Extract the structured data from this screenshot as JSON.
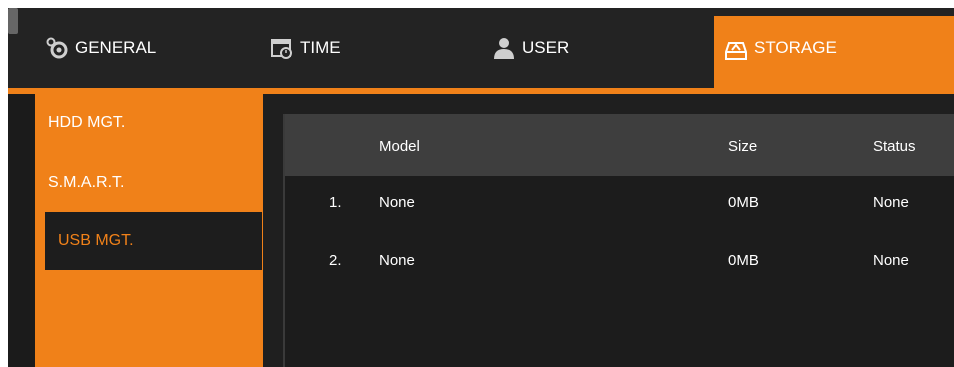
{
  "tabs": {
    "general": "GENERAL",
    "time": "TIME",
    "user": "USER",
    "storage": "STORAGE"
  },
  "sidebar": {
    "items": [
      {
        "label": "HDD MGT."
      },
      {
        "label": "S.M.A.R.T."
      },
      {
        "label": "USB MGT."
      }
    ]
  },
  "table": {
    "headers": {
      "model": "Model",
      "size": "Size",
      "status": "Status"
    },
    "rows": [
      {
        "num": "1.",
        "model": "None",
        "size": "0MB",
        "status": "None"
      },
      {
        "num": "2.",
        "model": "None",
        "size": "0MB",
        "status": "None"
      }
    ]
  },
  "colors": {
    "accent": "#f08119",
    "background": "#1b1b1b",
    "header": "#3e3e3e"
  },
  "icons": [
    "gear-icon",
    "calendar-icon",
    "user-icon",
    "storage-icon"
  ]
}
